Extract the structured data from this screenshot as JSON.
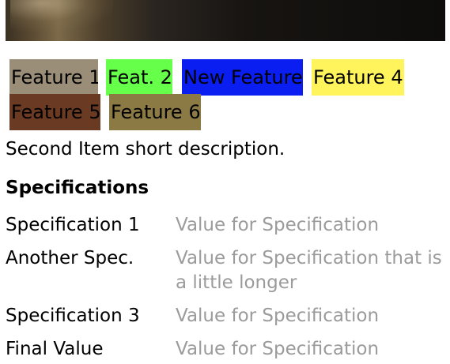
{
  "hero": {
    "image": "product-photo"
  },
  "features": [
    {
      "label": "Feature 1",
      "color": "#9b8e78"
    },
    {
      "label": "Feat. 2",
      "color": "#66ff4a"
    },
    {
      "label": "New Feature",
      "color": "#0a1ef2"
    },
    {
      "label": "Feature 4",
      "color": "#fff45c"
    },
    {
      "label": "Feature 5",
      "color": "#6b3a22"
    },
    {
      "label": "Feature 6",
      "color": "#8c7a45"
    }
  ],
  "description": "Second Item short description.",
  "specifications": {
    "title": "Specifications",
    "rows": [
      {
        "name": "Specification 1",
        "value": "Value for Specification"
      },
      {
        "name": "Another Spec.",
        "value": "Value for Specification that is a little longer"
      },
      {
        "name": "Specification 3",
        "value": "Value for Specification"
      },
      {
        "name": "Final Value",
        "value": "Value for Specification"
      }
    ]
  },
  "colors": {
    "value_text": "#9b9b9b"
  }
}
